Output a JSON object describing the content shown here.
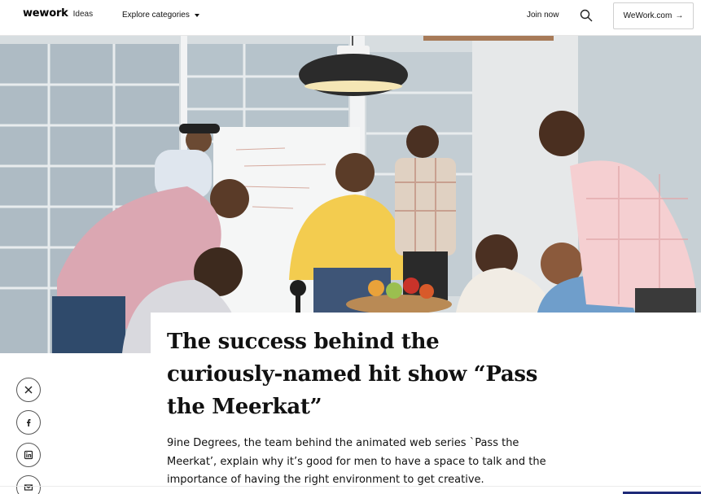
{
  "header": {
    "logo_text": "wework",
    "logo_sub": "Ideas",
    "explore_label": "Explore categories",
    "join_label": "Join now",
    "wework_button_label": "WeWork.com",
    "wework_button_arrow": "→"
  },
  "hero": {
    "alt_description_icon": "photo-hero"
  },
  "article": {
    "title": "The success behind the curiously-named hit show “Pass the Meerkat”",
    "deck": "9ine Degrees, the team behind the animated web series `Pass the Meerkat’, explain why it’s good for men to have a space to talk and the importance of having the right environment to get creative."
  },
  "social": {
    "icons": [
      "x-icon",
      "facebook-icon",
      "linkedin-icon",
      "email-icon"
    ]
  },
  "colors": {
    "accent": "#1e2a78",
    "text": "#111111"
  }
}
